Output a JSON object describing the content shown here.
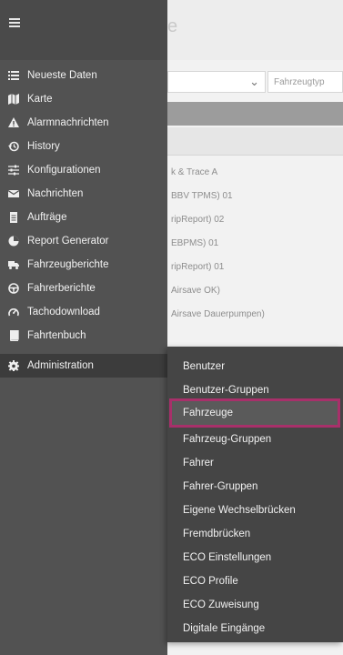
{
  "background": {
    "title": "e",
    "filter_placeholder": "Fahrzeugtyp",
    "rows": [
      "k & Trace A",
      "BBV TPMS) 01",
      "ripReport) 02",
      "EBPMS) 01",
      "ripReport) 01",
      "Airsave OK)",
      "Airsave Dauerpumpen)"
    ]
  },
  "sidebar": {
    "items": [
      {
        "label": "Neueste Daten",
        "icon": "list-icon"
      },
      {
        "label": "Karte",
        "icon": "map-icon"
      },
      {
        "label": "Alarmnachrichten",
        "icon": "warning-icon"
      },
      {
        "label": "History",
        "icon": "history-icon"
      },
      {
        "label": "Konfigurationen",
        "icon": "sliders-icon"
      },
      {
        "label": "Nachrichten",
        "icon": "envelope-icon"
      },
      {
        "label": "Aufträge",
        "icon": "document-icon"
      },
      {
        "label": "Report Generator",
        "icon": "pie-chart-icon"
      },
      {
        "label": "Fahrzeugberichte",
        "icon": "truck-icon"
      },
      {
        "label": "Fahrerberichte",
        "icon": "steering-wheel-icon"
      },
      {
        "label": "Tachodownload",
        "icon": "gauge-icon"
      },
      {
        "label": "Fahrtenbuch",
        "icon": "book-icon"
      },
      {
        "label": "Administration",
        "icon": "gear-icon"
      }
    ]
  },
  "submenu": {
    "items": [
      "Benutzer",
      "Benutzer-Gruppen",
      "Fahrzeuge",
      "Fahrzeug-Gruppen",
      "Fahrer",
      "Fahrer-Gruppen",
      "Eigene Wechselbrücken",
      "Fremdbrücken",
      "ECO Einstellungen",
      "ECO Profile",
      "ECO Zuweisung",
      "Digitale Eingänge"
    ],
    "selected": "Fahrzeuge"
  },
  "colors": {
    "drawer": "#525252",
    "submenu": "#454545",
    "highlight_border": "#a8306a"
  }
}
